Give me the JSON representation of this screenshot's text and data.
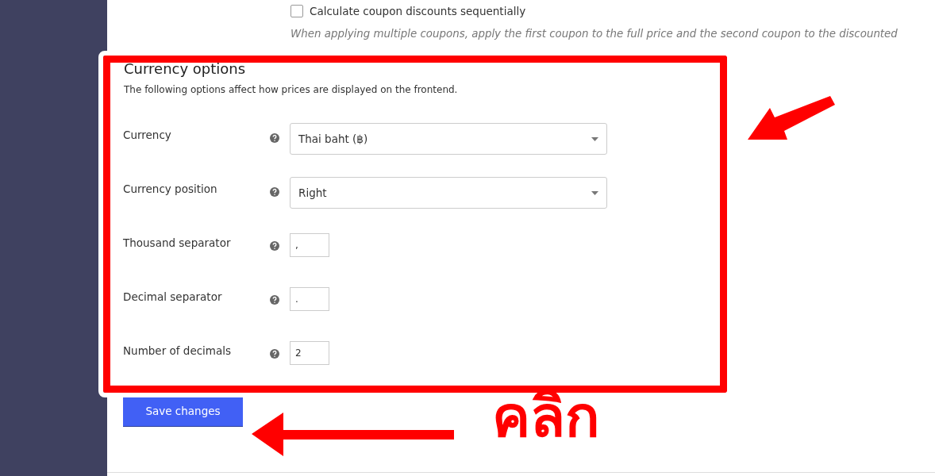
{
  "coupon_option": {
    "label": "Calculate coupon discounts sequentially",
    "checked": false,
    "help_text": "When applying multiple coupons, apply the first coupon to the full price and the second coupon to the discounted"
  },
  "section": {
    "title": "Currency options",
    "description": "The following options affect how prices are displayed on the frontend."
  },
  "fields": [
    {
      "label": "Currency",
      "kind": "select",
      "value": "Thai baht (฿)"
    },
    {
      "label": "Currency position",
      "kind": "select",
      "value": "Right"
    },
    {
      "label": "Thousand separator",
      "kind": "text",
      "value": ","
    },
    {
      "label": "Decimal separator",
      "kind": "text",
      "value": "."
    },
    {
      "label": "Number of decimals",
      "kind": "text",
      "value": "2"
    }
  ],
  "save_button": "Save changes",
  "annotation": {
    "callout": "คลิก"
  }
}
